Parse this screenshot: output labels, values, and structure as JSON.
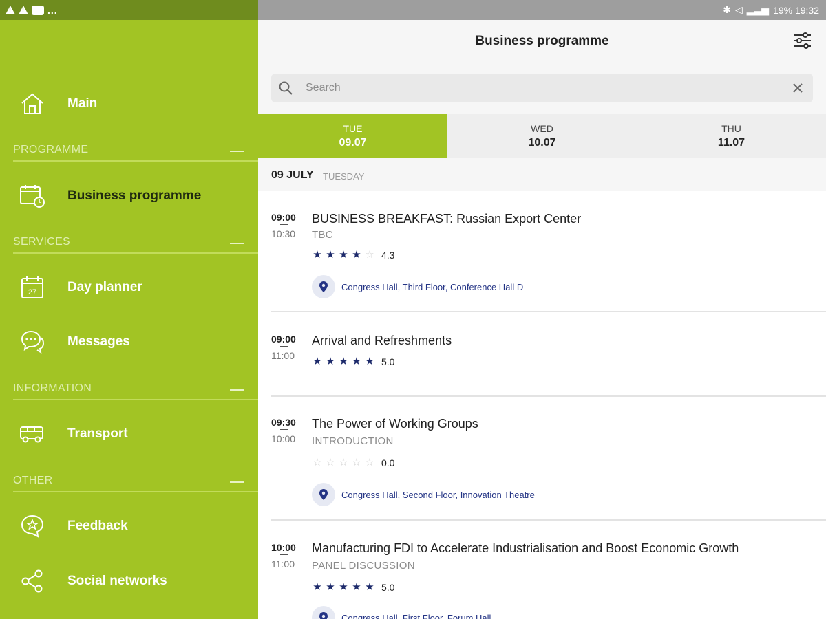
{
  "colors": {
    "accent": "#a2c424",
    "rating_star": "#1d2a6b",
    "location_text": "#243485",
    "status_left": "#6f8c1e"
  },
  "status_bar": {
    "right_text": "19%  19:32",
    "more": "..."
  },
  "sidebar": {
    "main": {
      "label": "Main",
      "icon": "home-icon"
    },
    "sections": [
      {
        "label": "PROGRAMME",
        "items": [
          {
            "label": "Business programme",
            "icon": "calendar-clock-icon"
          }
        ]
      },
      {
        "label": "SERVICES",
        "items": [
          {
            "label": "Day planner",
            "icon": "calendar-icon",
            "day": "27"
          },
          {
            "label": "Messages",
            "icon": "chat-bubbles-icon"
          }
        ]
      },
      {
        "label": "INFORMATION",
        "items": [
          {
            "label": "Transport",
            "icon": "bus-icon"
          }
        ]
      },
      {
        "label": "OTHER",
        "items": [
          {
            "label": "Feedback",
            "icon": "star-bubble-icon"
          },
          {
            "label": "Social networks",
            "icon": "share-icon"
          }
        ]
      }
    ]
  },
  "header": {
    "title": "Business programme",
    "filter_icon": "filter-sliders-icon"
  },
  "search": {
    "placeholder": "Search",
    "value": ""
  },
  "tabs": [
    {
      "dow": "TUE",
      "date": "09.07",
      "active": true
    },
    {
      "dow": "WED",
      "date": "10.07",
      "active": false
    },
    {
      "dow": "THU",
      "date": "11.07",
      "active": false
    }
  ],
  "day_header": {
    "main": "09 JULY",
    "sub": "TUESDAY"
  },
  "events": [
    {
      "start": "09:00",
      "end": "10:30",
      "title": "BUSINESS BREAKFAST: Russian Export Center",
      "type": "TBC",
      "stars": 4,
      "rating": "4.3",
      "location": "Congress Hall, Third Floor, Conference Hall D"
    },
    {
      "start": "09:00",
      "end": "11:00",
      "title": "Arrival and Refreshments",
      "type": "",
      "stars": 5,
      "rating": "5.0",
      "location": ""
    },
    {
      "start": "09:30",
      "end": "10:00",
      "title": "The Power of Working Groups",
      "type": "INTRODUCTION",
      "stars": 0,
      "rating": "0.0",
      "location": "Congress Hall, Second Floor, Innovation Theatre"
    },
    {
      "start": "10:00",
      "end": "11:00",
      "title": "Manufacturing FDI to Accelerate Industrialisation and Boost Economic Growth",
      "type": "PANEL DISCUSSION",
      "stars": 5,
      "rating": "5.0",
      "location": "Congress Hall, First Floor, Forum Hall"
    }
  ]
}
